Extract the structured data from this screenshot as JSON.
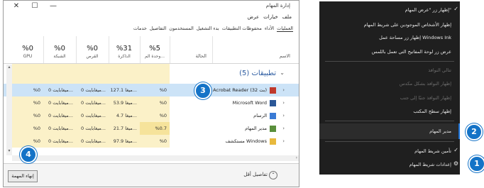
{
  "task_manager": {
    "title": "إدارة المهام",
    "menu": [
      "ملف",
      "خيارات",
      "عرض"
    ],
    "tabs": [
      "العمليات",
      "الأداء",
      "محفوظات التطبيقات",
      "بدء التشغيل",
      "المستخدمون",
      "التفاصيل",
      "خدمات"
    ],
    "active_tab": "العمليات",
    "columns": [
      {
        "pct": "%5",
        "label": "وحدة الم..."
      },
      {
        "pct": "%31",
        "label": "الذاكرة"
      },
      {
        "pct": "%0",
        "label": "القرص"
      },
      {
        "pct": "%0",
        "label": "الشبكة"
      },
      {
        "pct": "%0",
        "label": "GPU"
      }
    ],
    "name_header": "الاسم",
    "status_header": "الحالة",
    "section": "تطبيقات (5)",
    "rows": [
      {
        "name": "Adobe Acrobat Reader (32 بت)",
        "cpu": "%0",
        "mem": "127.1 ميغا...",
        "disk": "0 ميغابايت...",
        "net": "0 ميغابايت...",
        "gpu": "%0",
        "icon_color": "#c0392b"
      },
      {
        "name": "Microsoft Word",
        "cpu": "%0",
        "mem": "53.9 ميغا...",
        "disk": "0 ميغابايت...",
        "net": "0 ميغابايت...",
        "gpu": "%0",
        "icon_color": "#2b5797"
      },
      {
        "name": "الرسام",
        "cpu": "%0",
        "mem": "4.7 ميغا...",
        "disk": "0 ميغابايت...",
        "net": "0 ميغابايت...",
        "gpu": "%0",
        "icon_color": "#3a7bd5"
      },
      {
        "name": "مدير المهام",
        "cpu": "%0.7",
        "mem": "21.7 ميغا...",
        "disk": "0 ميغابايت...",
        "net": "0 ميغابايت...",
        "gpu": "%0",
        "icon_color": "#5a8f3c"
      },
      {
        "name": "مستكشف Windows",
        "cpu": "%0",
        "mem": "97.9 ميغا...",
        "disk": "0 ميغابايت...",
        "net": "0 ميغابايت...",
        "gpu": "%0",
        "icon_color": "#e8b93d"
      }
    ],
    "footer": {
      "details": "تفاصيل أقل",
      "end_task": "إنهاء المهمة"
    }
  },
  "context_menu": {
    "items": [
      "إظهار زر \"عرض المهام\"",
      "إظهار الأشخاص الموجودين على شريط المهام",
      "إظهار زر مساحة عمل Windows Ink",
      "عرض زر لوحة المفاتيح التي تعمل باللمس",
      "تتالي النوافذ",
      "إظهار النوافذ بشكل مكدس",
      "إظهار النوافذ جنبًا إلى جنب",
      "إظهار سطح المكتب",
      "مدير المهام",
      "تأمين شريط المهام",
      "إعدادات شريط المهام"
    ]
  },
  "callouts": [
    "1",
    "2",
    "3",
    "4"
  ],
  "colors": {
    "accent": "#1473c7",
    "menu_bg": "#1f1f1f",
    "heat": "#fbf1c8",
    "selected_row": "#cce3f7"
  }
}
